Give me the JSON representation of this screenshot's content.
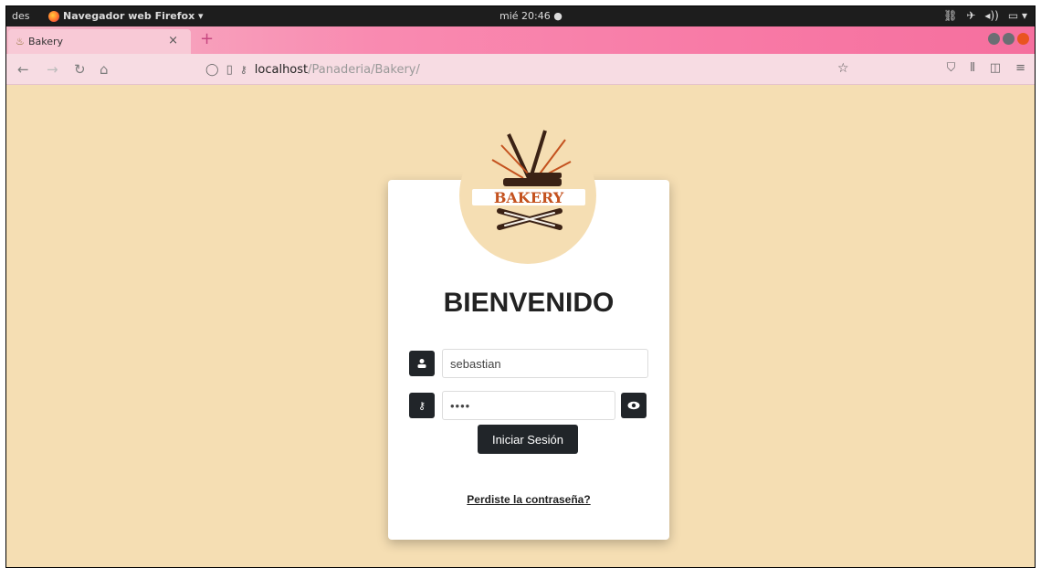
{
  "system_bar": {
    "activities": "des",
    "app_menu": "Navegador web Firefox ▾",
    "clock": "mié 20:46 ●",
    "tray": [
      "⛓",
      "✈",
      "◂))",
      "▭ ▾"
    ]
  },
  "browser": {
    "tab_title": "Bakery",
    "tab_close": "×",
    "new_tab": "+",
    "url_host": "localhost",
    "url_path": "/Panaderia/Bakery/",
    "icons": [
      "back-arrow",
      "forward-arrow",
      "reload",
      "home",
      "shield",
      "page",
      "key",
      "star",
      "pocket",
      "library",
      "sidebar",
      "menu"
    ]
  },
  "login": {
    "logo_text": "BAKERY",
    "welcome": "BIENVENIDO",
    "username_value": "sebastian",
    "password_value": "••••",
    "submit_label": "Iniciar Sesión",
    "forgot_label": "Perdiste la contraseña?"
  },
  "colors": {
    "page_background": "#f5deb3",
    "button_dark": "#212529",
    "logo_brown": "#c4521f"
  }
}
